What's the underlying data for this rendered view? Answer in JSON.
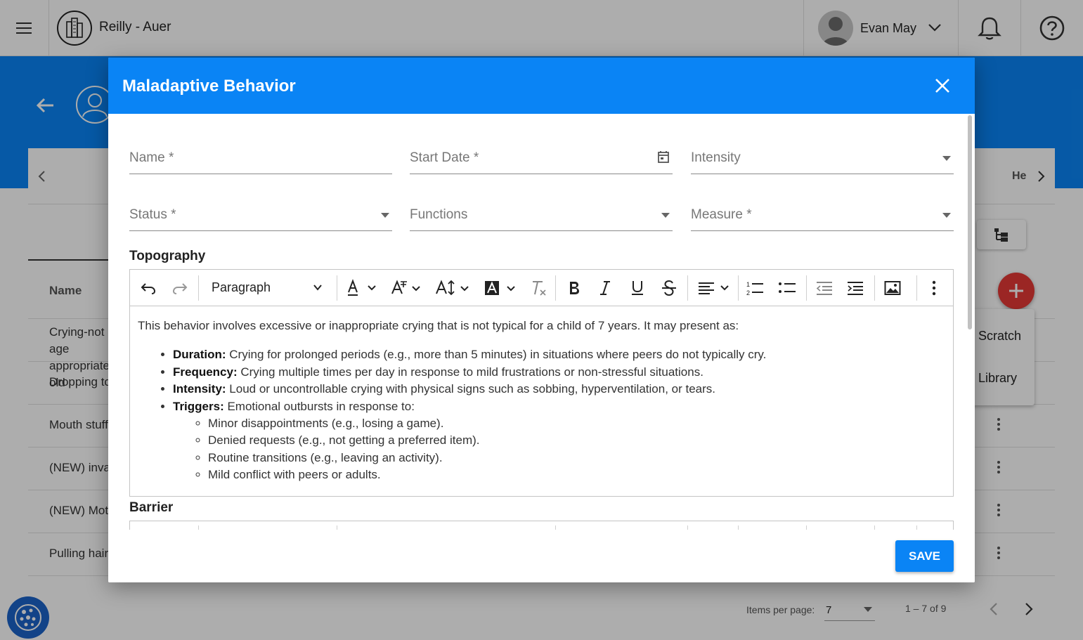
{
  "header": {
    "org_name": "Reilly - Auer",
    "user_name": "Evan May"
  },
  "tabs": {
    "partial_tab": "He"
  },
  "table": {
    "name_header": "Name",
    "rows": [
      {
        "name": "Crying-not age appropriate old"
      },
      {
        "name": "Dropping to the floor"
      },
      {
        "name": "Mouth stuffing"
      },
      {
        "name": "(NEW) invading personal space"
      },
      {
        "name": "(NEW) Motor stereotypy"
      },
      {
        "name": "Pulling hair"
      }
    ]
  },
  "fab_menu": {
    "items": [
      "Scratch",
      "Library"
    ]
  },
  "pagination": {
    "items_per_page_label": "Items per page:",
    "items_per_page_value": "7",
    "range": "1 – 7 of 9"
  },
  "modal": {
    "title": "Maladaptive Behavior",
    "fields": {
      "name": "Name *",
      "start_date": "Start Date *",
      "intensity": "Intensity",
      "status": "Status *",
      "functions": "Functions",
      "measure": "Measure *"
    },
    "topography_title": "Topography",
    "barrier_title": "Barrier",
    "save_label": "SAVE",
    "toolbar": {
      "paragraph_style": "Paragraph"
    },
    "topography": {
      "intro": "This behavior involves excessive or inappropriate crying that is not typical for a child of 7 years. It may present as:",
      "bullets": [
        {
          "term": "Duration:",
          "text": " Crying for prolonged periods (e.g., more than 5 minutes) in situations where peers do not typically cry."
        },
        {
          "term": "Frequency:",
          "text": " Crying multiple times per day in response to mild frustrations or non-stressful situations."
        },
        {
          "term": "Intensity:",
          "text": " Loud or uncontrollable crying with physical signs such as sobbing, hyperventilation, or tears."
        },
        {
          "term": "Triggers:",
          "text": " Emotional outbursts in response to:"
        }
      ],
      "triggers": [
        "Minor disappointments (e.g., losing a game).",
        "Denied requests (e.g., not getting a preferred item).",
        "Routine transitions (e.g., leaving an activity).",
        "Mild conflict with peers or adults."
      ]
    }
  },
  "colors": {
    "primary": "#0a84f5",
    "fab": "#e53935"
  }
}
